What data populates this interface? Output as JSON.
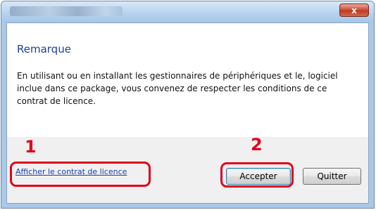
{
  "dialog": {
    "title_bar": {
      "close_label": "x"
    },
    "heading": "Remarque",
    "message": "En utilisant ou en installant les gestionnaires de périphériques et le, logiciel inclue dans ce package, vous convenez de respecter les conditions de ce contrat de licence.",
    "link_label": "Afficher le contrat de licence",
    "buttons": {
      "accept_label": "Accepter",
      "quit_label": "Quitter"
    }
  },
  "annotations": {
    "step1_label": "1",
    "step2_label": "2",
    "color": "#e0001b"
  }
}
